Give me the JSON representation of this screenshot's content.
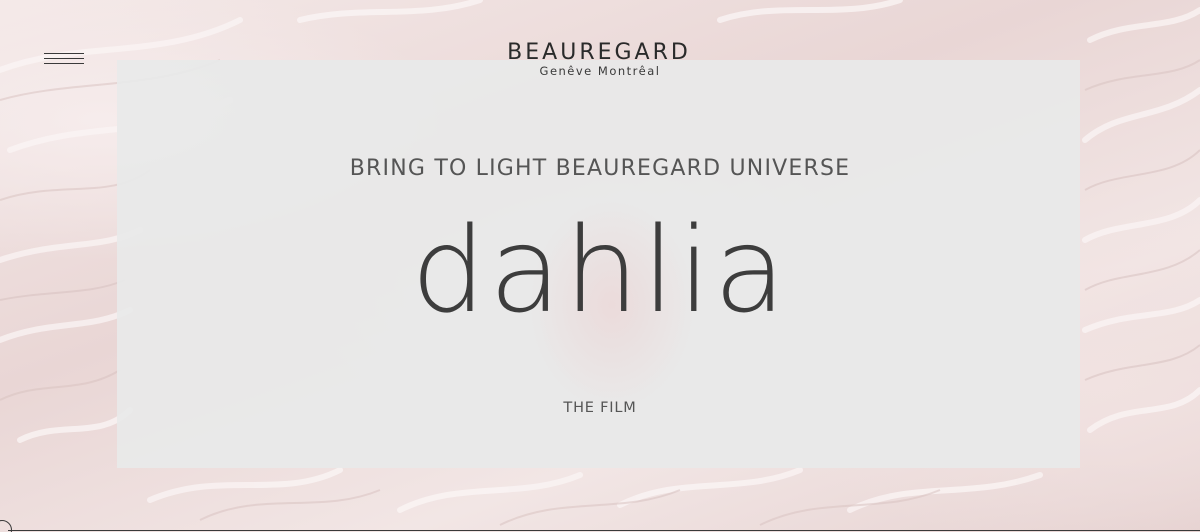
{
  "brand": {
    "name": "BEAUREGARD",
    "cities": "Genêve Montrêal"
  },
  "hero": {
    "kicker": "BRING TO LIGHT BEAUREGARD UNIVERSE",
    "headline": "dahlia",
    "cta_label": "THE FILM"
  },
  "menu": {
    "icon": "hamburger-menu-icon"
  },
  "colors": {
    "background": "#f0e2e1",
    "panel": "#e8e9e9",
    "text": "#3d3d3d"
  }
}
